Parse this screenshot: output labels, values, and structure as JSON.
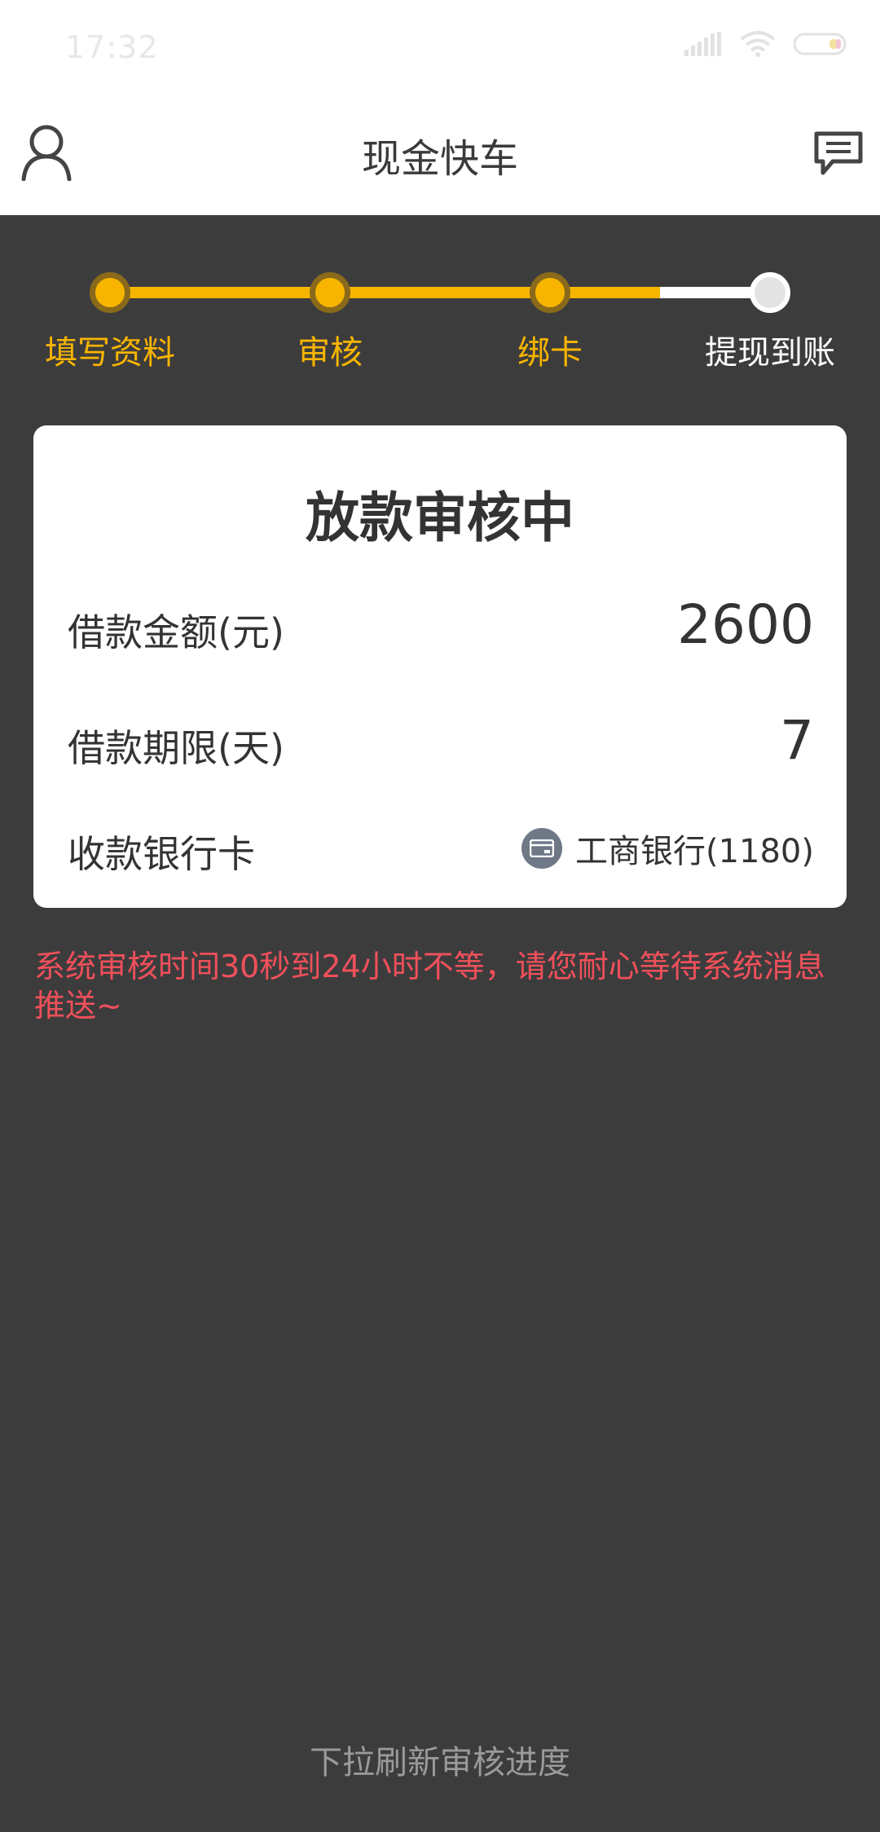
{
  "status_bar": {
    "time": "17:32"
  },
  "header": {
    "title": "现金快车",
    "left_icon": "user-icon",
    "right_icon": "message-icon"
  },
  "steps": [
    {
      "label": "填写资料",
      "state": "done"
    },
    {
      "label": "审核",
      "state": "done"
    },
    {
      "label": "绑卡",
      "state": "done"
    },
    {
      "label": "提现到账",
      "state": "todo"
    }
  ],
  "card": {
    "title": "放款审核中",
    "amount_label": "借款金额(元)",
    "amount_value": "2600",
    "term_label": "借款期限(天)",
    "term_value": "7",
    "bank_label": "收款银行卡",
    "bank_value": "工商银行(1180)",
    "bank_icon": "card-icon"
  },
  "notice": "系统审核时间30秒到24小时不等，请您耐心等待系统消息推送~",
  "footer": {
    "refresh_hint": "下拉刷新审核进度"
  },
  "colors": {
    "accent": "#f7b500",
    "background": "#3d3c3d",
    "notice": "#f0505a"
  }
}
